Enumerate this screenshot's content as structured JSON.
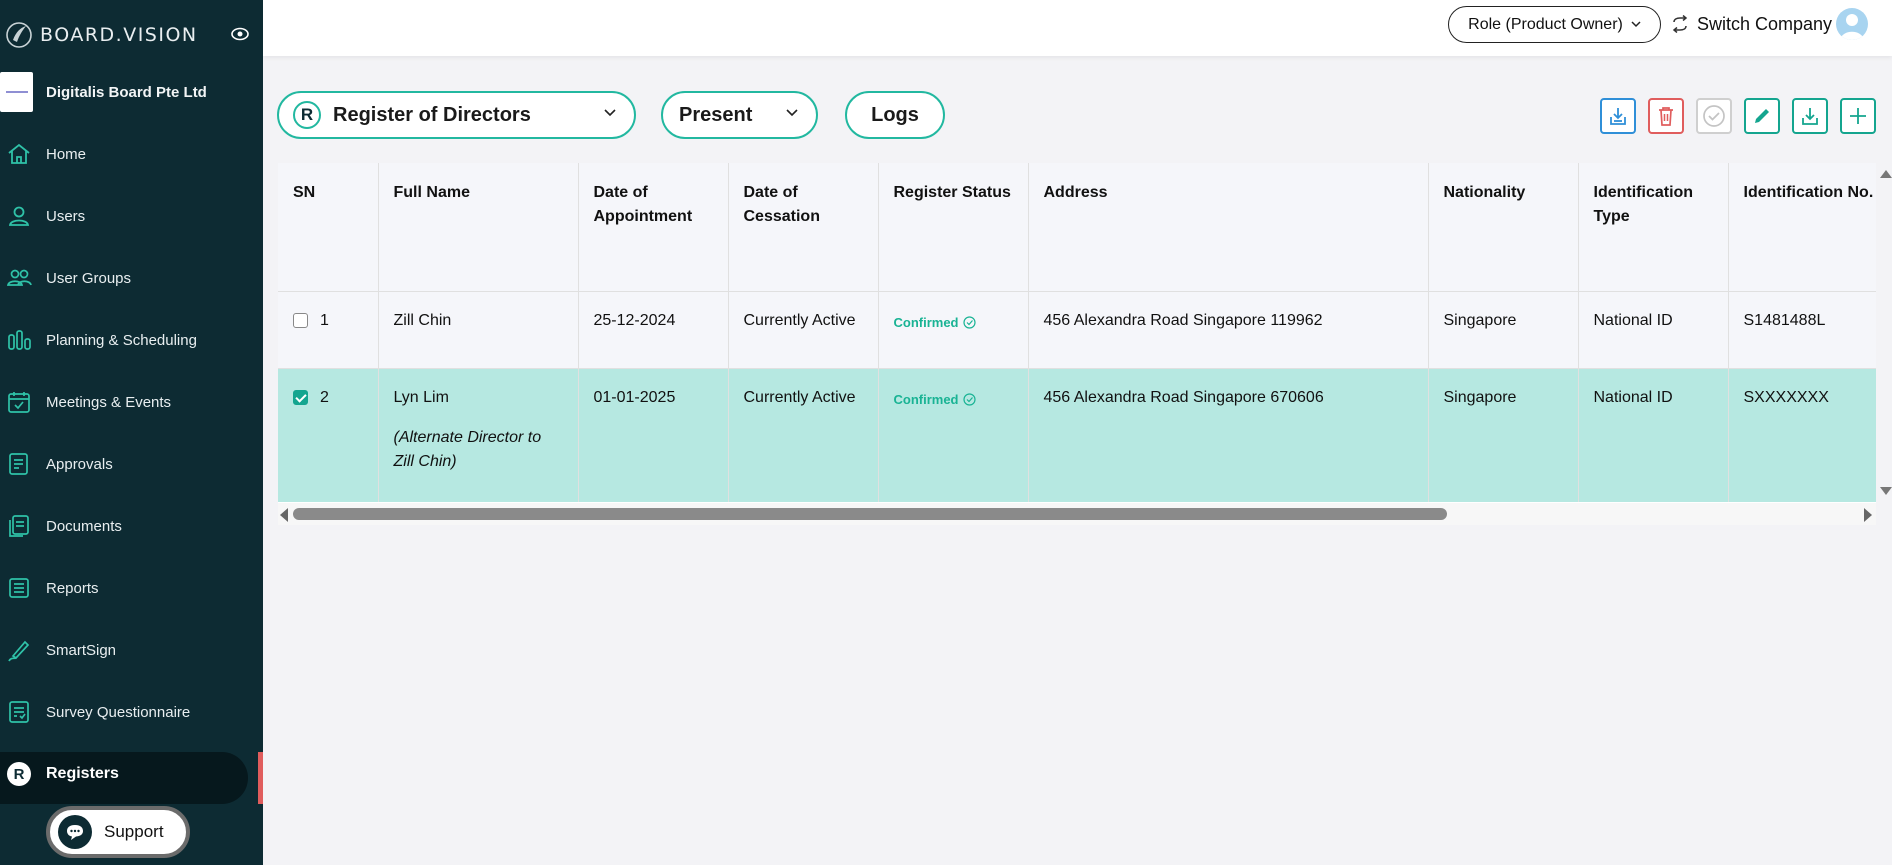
{
  "brand": {
    "logo_text": "BOARD.VISION"
  },
  "company": {
    "name": "Digitalis Board Pte Ltd"
  },
  "sidebar": {
    "items": [
      {
        "label": "Home",
        "icon": "home-icon"
      },
      {
        "label": "Users",
        "icon": "user-icon"
      },
      {
        "label": "User Groups",
        "icon": "user-groups-icon"
      },
      {
        "label": "Planning & Scheduling",
        "icon": "bar-chart-icon"
      },
      {
        "label": "Meetings & Events",
        "icon": "calendar-icon"
      },
      {
        "label": "Approvals",
        "icon": "approvals-icon"
      },
      {
        "label": "Documents",
        "icon": "documents-icon"
      },
      {
        "label": "Reports",
        "icon": "reports-icon"
      },
      {
        "label": "SmartSign",
        "icon": "pen-icon"
      },
      {
        "label": "Survey Questionnaire",
        "icon": "survey-icon"
      },
      {
        "label": "Registers",
        "icon": "registers-icon",
        "badge": "R",
        "active": true
      }
    ],
    "support_label": "Support"
  },
  "topbar": {
    "role_label": "Role (Product Owner)",
    "switch_company_label": "Switch Company"
  },
  "filters": {
    "register_badge": "R",
    "register_selected": "Register of Directors",
    "period_selected": "Present",
    "logs_label": "Logs"
  },
  "toolbar": {
    "actions": [
      "import-icon",
      "delete-icon",
      "approve-icon",
      "edit-icon",
      "download-icon",
      "add-icon"
    ]
  },
  "table": {
    "columns": [
      "SN",
      "Full Name",
      "Date of Appointment",
      "Date of Cessation",
      "Register Status",
      "Address",
      "Nationality",
      "Identification Type",
      "Identification No."
    ],
    "rows": [
      {
        "sn": "1",
        "checked": false,
        "full_name": "Zill Chin",
        "note": "",
        "appointment": "25-12-2024",
        "cessation": "Currently Active",
        "status": "Confirmed",
        "address": "456 Alexandra Road Singapore 119962",
        "nationality": "Singapore",
        "id_type": "National ID",
        "id_no": "S1481488L"
      },
      {
        "sn": "2",
        "checked": true,
        "full_name": "Lyn Lim",
        "note": "(Alternate Director to Zill Chin)",
        "appointment": "01-01-2025",
        "cessation": "Currently Active",
        "status": "Confirmed",
        "address": "456 Alexandra Road Singapore 670606",
        "nationality": "Singapore",
        "id_type": "National ID",
        "id_no": "SXXXXXXX"
      }
    ]
  },
  "colors": {
    "sidebar_bg": "#0d2b33",
    "accent_teal": "#22b8a0",
    "selected_row": "#b6e8e1",
    "delete_red": "#e05d5d",
    "import_blue": "#2f8fd8"
  }
}
